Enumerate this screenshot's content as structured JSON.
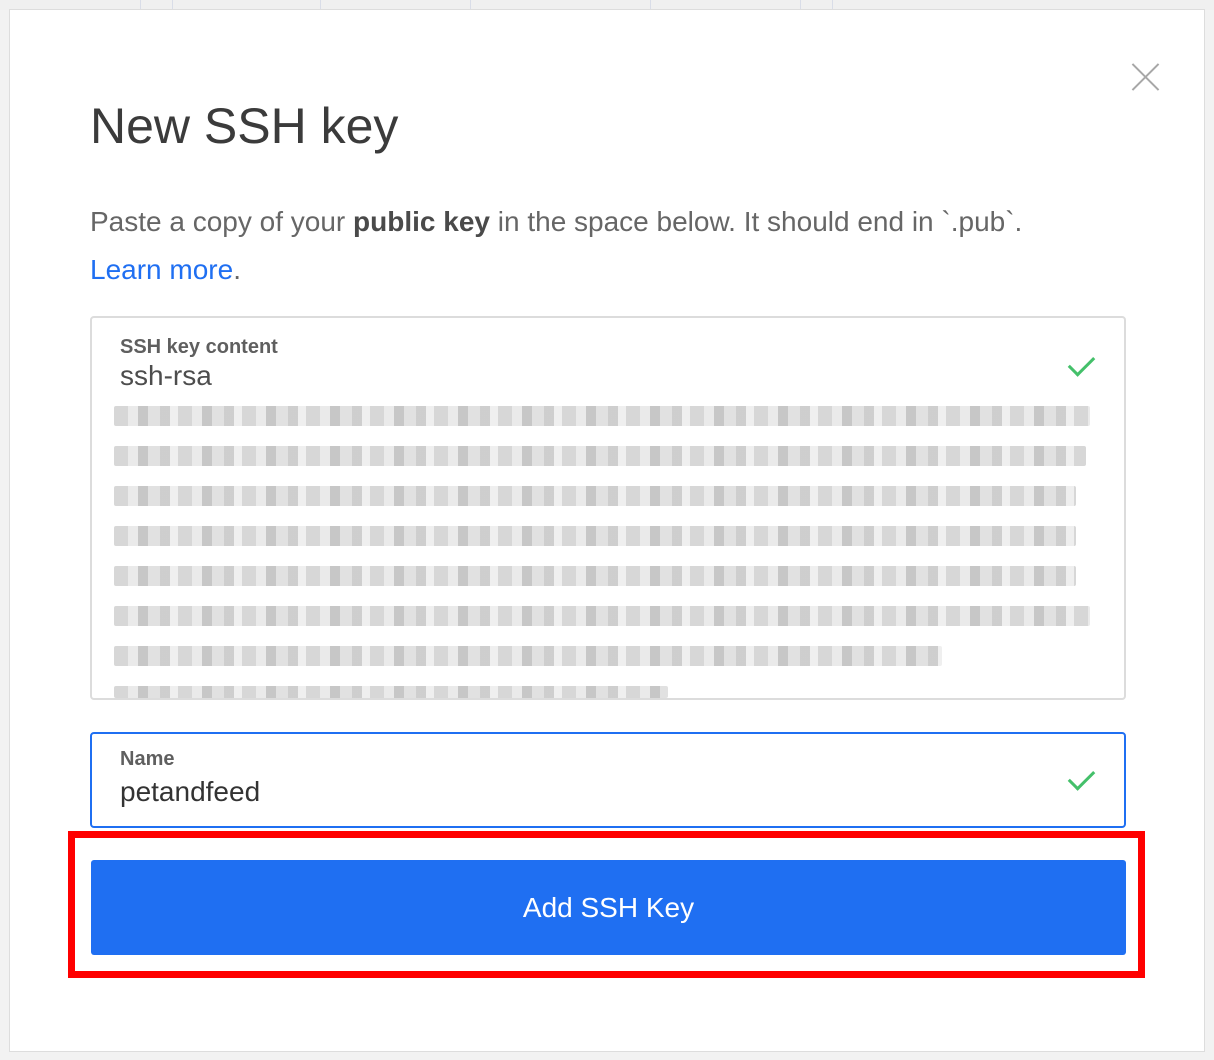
{
  "modal": {
    "title": "New SSH key",
    "description": {
      "part1": "Paste a copy of your ",
      "bold": "public key",
      "part2": " in the space below. It should end in `.pub`.",
      "link": "Learn more",
      "end": "."
    },
    "ssh_key_field": {
      "label": "SSH key content",
      "value": "ssh-rsa"
    },
    "name_field": {
      "label": "Name",
      "value": "petandfeed"
    },
    "submit_label": "Add SSH Key"
  },
  "colors": {
    "primary": "#1f6ff2",
    "valid_check": "#44c06a",
    "highlight": "#ff0000"
  },
  "icons": {
    "close": "close-icon",
    "valid": "check-icon"
  }
}
